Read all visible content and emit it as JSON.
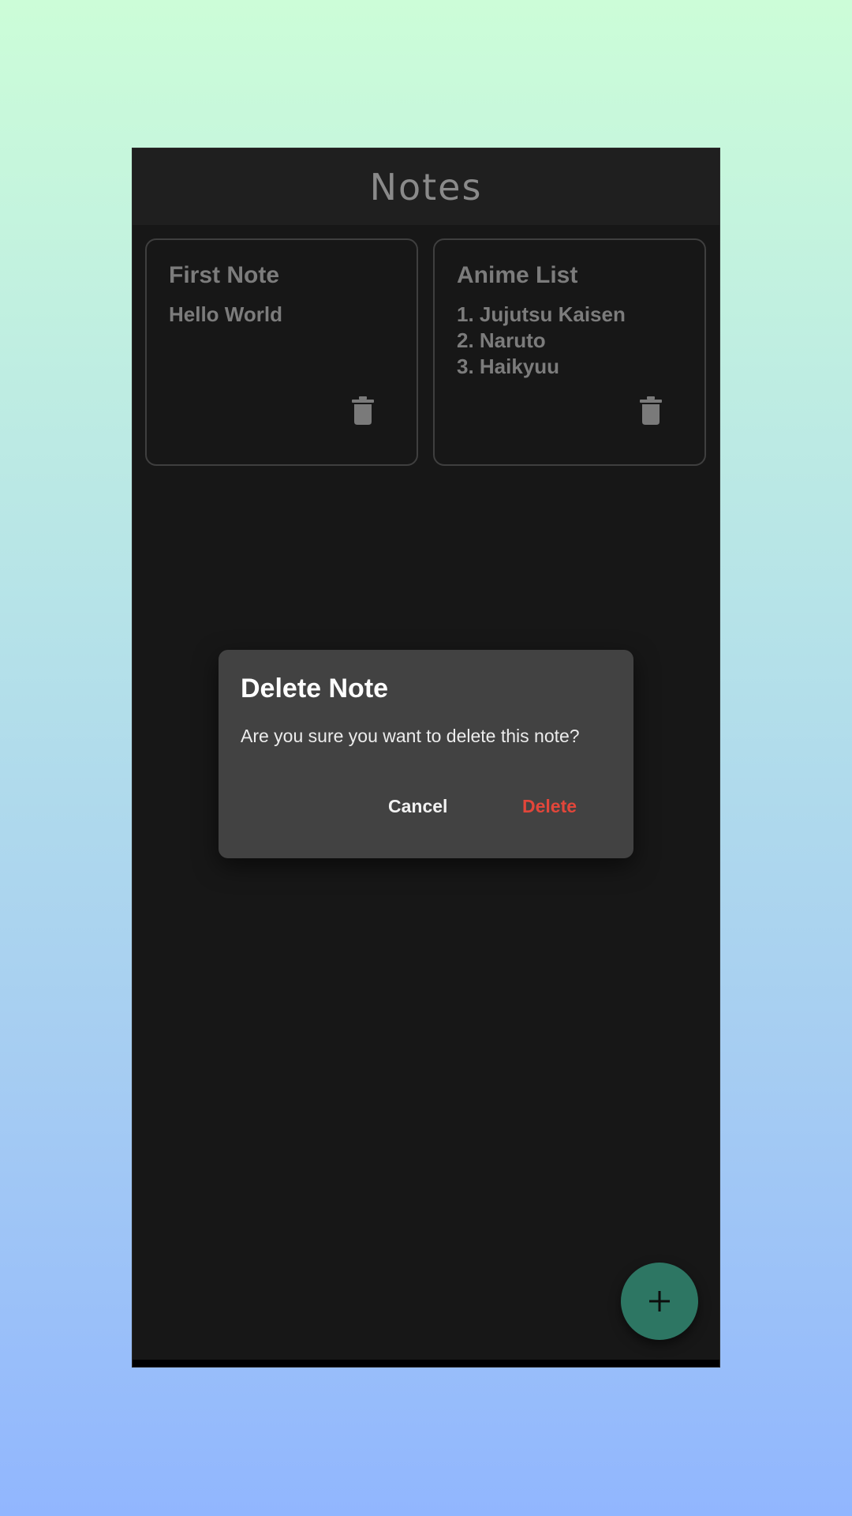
{
  "appbar": {
    "title": "Notes"
  },
  "notes": [
    {
      "title": "First Note",
      "lines": [
        "Hello World"
      ]
    },
    {
      "title": "Anime List",
      "lines": [
        "1. Jujutsu Kaisen",
        "2. Naruto",
        "3. Haikyuu"
      ]
    }
  ],
  "dialog": {
    "title": "Delete Note",
    "message": "Are you sure you want to delete this note?",
    "cancel_label": "Cancel",
    "delete_label": "Delete"
  },
  "fab": {
    "icon": "plus-icon"
  },
  "colors": {
    "accent": "#2d7663",
    "danger": "#e2463a",
    "dialog_bg": "#424242",
    "app_bg": "#171717"
  }
}
